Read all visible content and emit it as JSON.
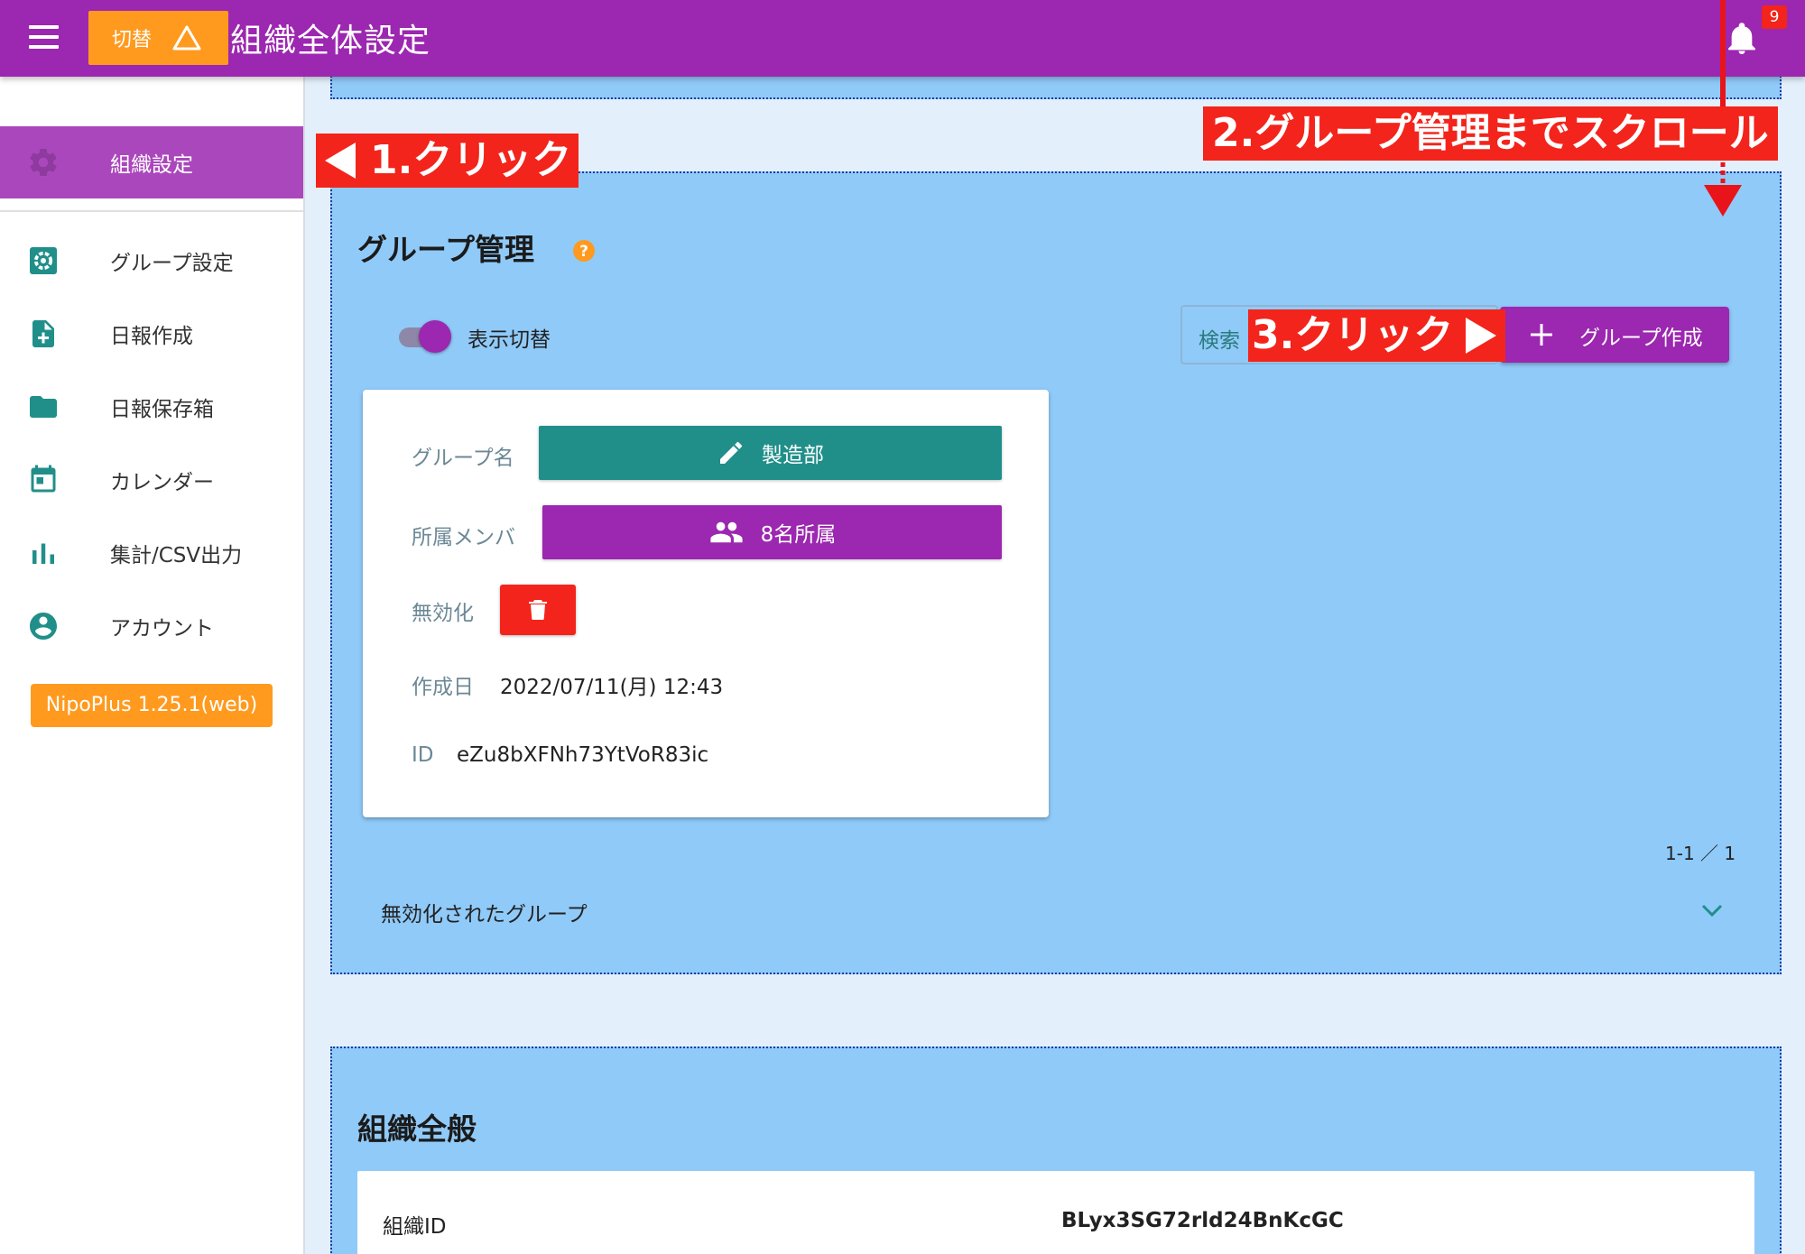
{
  "appbar": {
    "switch_label": "切替",
    "title": "組織全体設定",
    "notification_count": "9"
  },
  "sidebar": {
    "items": [
      {
        "label": "組織設定",
        "icon": "gear-icon",
        "active": true
      },
      {
        "label": "グループ設定",
        "icon": "gear-box-icon"
      },
      {
        "label": "日報作成",
        "icon": "file-plus-icon"
      },
      {
        "label": "日報保存箱",
        "icon": "folder-icon"
      },
      {
        "label": "カレンダー",
        "icon": "calendar-icon"
      },
      {
        "label": "集計/CSV出力",
        "icon": "bar-chart-icon"
      },
      {
        "label": "アカウント",
        "icon": "account-circle-icon"
      }
    ],
    "version": "NipoPlus 1.25.1(web)"
  },
  "group_section": {
    "title": "グループ管理",
    "toggle_label": "表示切替",
    "toggle_on": true,
    "search_label": "検索",
    "create_label": "グループ作成",
    "card": {
      "name_label": "グループ名",
      "name_value": "製造部",
      "members_label": "所属メンバ",
      "members_value": "8名所属",
      "disable_label": "無効化",
      "created_label": "作成日",
      "created_value": "2022/07/11(月) 12:43",
      "id_label": "ID",
      "id_value": "eZu8bXFNh73YtVoR83ic"
    },
    "pagination": "1-1 ／ 1",
    "disabled_groups_label": "無効化されたグループ"
  },
  "org_section": {
    "title": "組織全般",
    "org_id_label": "組織ID",
    "org_id_value": "BLyx3SG72rld24BnKcGC"
  },
  "annotations": {
    "step1": "1.クリック",
    "step2": "2.グループ管理までスクロール",
    "step3": "3.クリック"
  },
  "colors": {
    "primary": "#9c27b0",
    "accent_orange": "#ff9a1e",
    "teal": "#208f8a",
    "danger": "#f3241b",
    "panel_blue": "#90caf9"
  }
}
